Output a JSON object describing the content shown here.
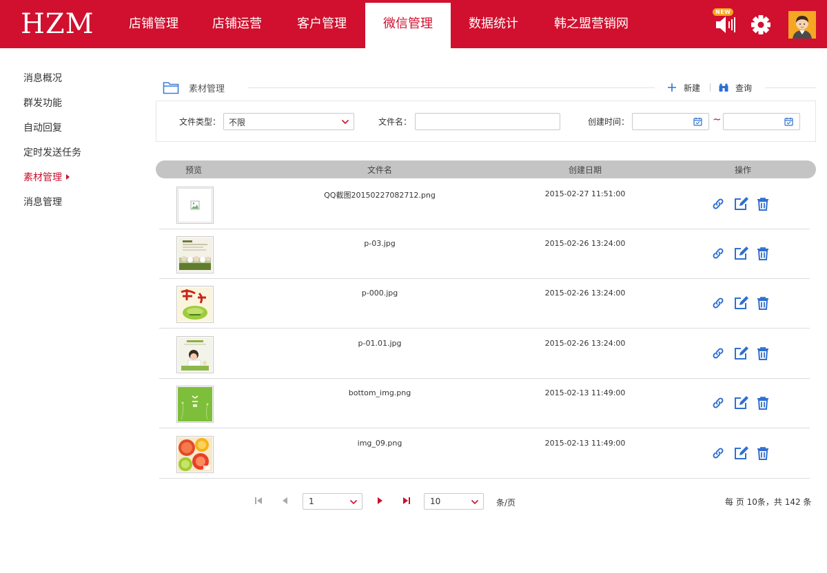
{
  "header": {
    "logo": "HZM",
    "nav": [
      "店铺管理",
      "店铺运营",
      "客户管理",
      "微信管理",
      "数据统计",
      "韩之盟营销网"
    ],
    "active_nav_index": 3,
    "badge": "NEW",
    "brand_color": "#d0102e"
  },
  "sidebar": {
    "items": [
      "消息概况",
      "群发功能",
      "自动回复",
      "定时发送任务",
      "素材管理",
      "消息管理"
    ],
    "active_index": 4
  },
  "section": {
    "title": "素材管理",
    "new_label": "新建",
    "query_label": "查询"
  },
  "filter": {
    "type_label": "文件类型：",
    "type_value": "不限",
    "name_label": "文件名：",
    "name_value": "",
    "time_label": "创建时间：",
    "time_from": "",
    "time_to": "",
    "range_sep": "~"
  },
  "table": {
    "columns": [
      "预览",
      "文件名",
      "创建日期",
      "操作"
    ],
    "rows": [
      {
        "name": "QQ截图20150227082712.png",
        "date": "2015-02-27 11:51:00",
        "thumb": "broken-image"
      },
      {
        "name": "p-03.jpg",
        "date": "2015-02-26 13:24:00",
        "thumb": "newsletter-thumb"
      },
      {
        "name": "p-000.jpg",
        "date": "2015-02-26 13:24:00",
        "thumb": "new-year-thumb"
      },
      {
        "name": "p-01.01.jpg",
        "date": "2015-02-26 13:24:00",
        "thumb": "child-reading-thumb"
      },
      {
        "name": "bottom_img.png",
        "date": "2015-02-13 11:49:00",
        "thumb": "green-thumb"
      },
      {
        "name": "img_09.png",
        "date": "2015-02-13 11:49:00",
        "thumb": "fruit-thumb"
      }
    ]
  },
  "pagination": {
    "page": "1",
    "page_size": "10",
    "per_page_unit": "条/页",
    "summary": "每 页 10条，共 142 条"
  }
}
